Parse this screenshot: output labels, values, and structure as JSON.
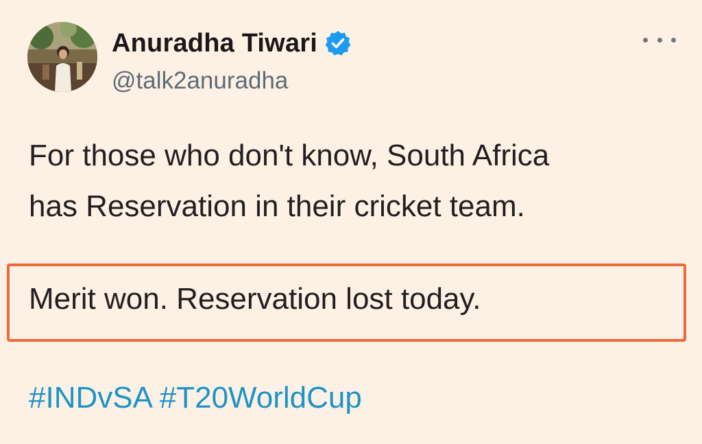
{
  "author": {
    "name": "Anuradha Tiwari",
    "handle": "@talk2anuradha",
    "verified": true
  },
  "tweet": {
    "lines": [
      "For those who don't know, South Africa",
      "has Reservation in their cricket team."
    ],
    "highlighted_text": "Merit won. Reservation lost today.",
    "hashtags": [
      "#INDvSA",
      "#T20WorldCup"
    ]
  },
  "icons": {
    "verified": "verified-badge-icon",
    "more": "more-options-icon"
  },
  "colors": {
    "background": "#fdf1e5",
    "hashtag": "#1d93c6",
    "verified": "#1d9bf0",
    "highlight_border": "#ee6a3b",
    "handle": "#5f6b74"
  }
}
